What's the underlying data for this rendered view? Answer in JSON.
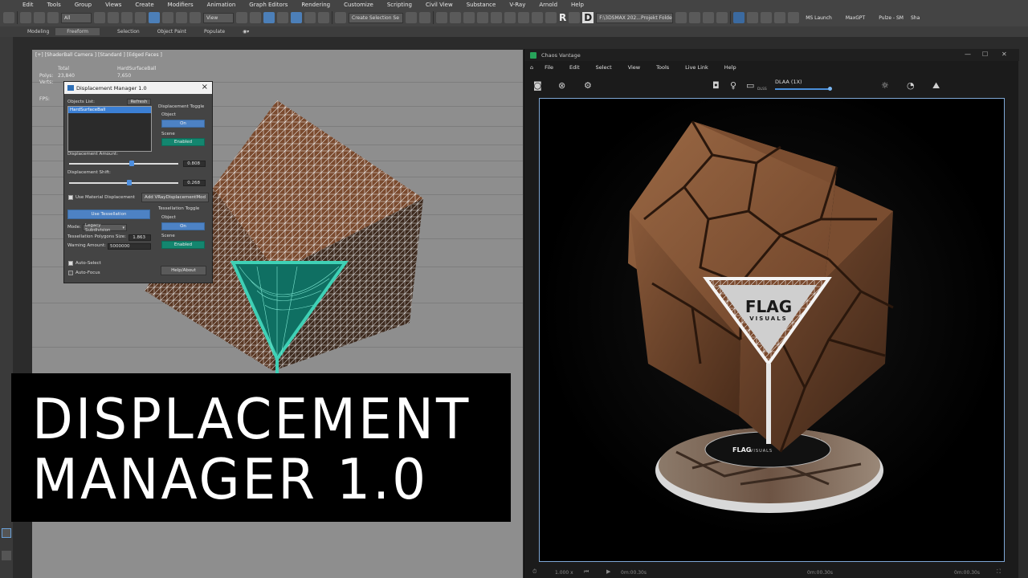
{
  "max": {
    "menu": [
      "Edit",
      "Tools",
      "Group",
      "Views",
      "Create",
      "Modifiers",
      "Animation",
      "Graph Editors",
      "Rendering",
      "Customize",
      "Scripting",
      "Civil View",
      "Substance",
      "V-Ray",
      "Arnold",
      "Help"
    ],
    "toolbar": {
      "filter_value": "All",
      "view_value": "View",
      "selection_set": "Create Selection Se",
      "project_path": "F:\\3DSMAX 202...Projekt Folde",
      "plugins": [
        "MS Launch",
        "MaxGPT",
        "Pulze - SM",
        "Sha"
      ],
      "big_letters": [
        "R",
        "D"
      ]
    },
    "ribbon_tabs": [
      "Modeling",
      "Freeform",
      "Selection",
      "Object Paint",
      "Populate"
    ],
    "viewport": {
      "label": "[+] [ShaderBall Camera ] [Standard ] [Edged Faces ]",
      "stats": [
        "Total",
        "HardSurfaceBall",
        "Polys:",
        "23,840",
        "7,650",
        "Verts:"
      ],
      "fps_label": "FPS:"
    }
  },
  "dialog": {
    "title": "Displacement Manager 1.0",
    "objects_list_label": "Objects List:",
    "refresh_label": "Refresh",
    "objects": [
      "HardSurfaceBall"
    ],
    "displacement_toggle": "Displacement Toggle",
    "object_label": "Object",
    "on_label": "On",
    "scene_label": "Scene",
    "enabled_label": "Enabled",
    "amount_label": "Displacement Amount:",
    "amount_value": "0.808",
    "amount_fraction": 0.57,
    "shift_label": "Displacement Shift:",
    "shift_value": "0.268",
    "shift_fraction": 0.55,
    "use_material_label": "Use Material Displacement",
    "add_mod_label": "Add VRayDisplacementMod",
    "use_tessellation_label": "Use Tessellation",
    "tessellation_toggle": "Tessellation Toggle",
    "mode_label": "Mode:",
    "mode_value": "Legacy Subdivision",
    "polygon_size_label": "Tessellation Polygons Size:",
    "polygon_size_value": "1.863",
    "warning_label": "Warning Amount:",
    "warning_value": "5000000",
    "auto_select_label": "Auto-Select",
    "auto_focus_label": "Auto-Focus",
    "help_label": "Help/About",
    "colors": {
      "blue": "#4d82c4",
      "teal": "#13866f"
    }
  },
  "overlay": {
    "line1": "DISPLACEMENT",
    "line2": "MANAGER 1.0"
  },
  "vantage": {
    "title": "Chaos Vantage",
    "menu": [
      "File",
      "Edit",
      "Select",
      "View",
      "Tools",
      "Live Link",
      "Help"
    ],
    "dlaa": "DLAA (1X)",
    "dlss": "DLSS",
    "logo_text": "FLAG",
    "logo_sub": "VISUALS",
    "status_left": "1.000 x",
    "status_time_1": "0m:00.30s",
    "status_time_2": "0m:00.30s",
    "status_time_3": "0m:00.30s"
  }
}
